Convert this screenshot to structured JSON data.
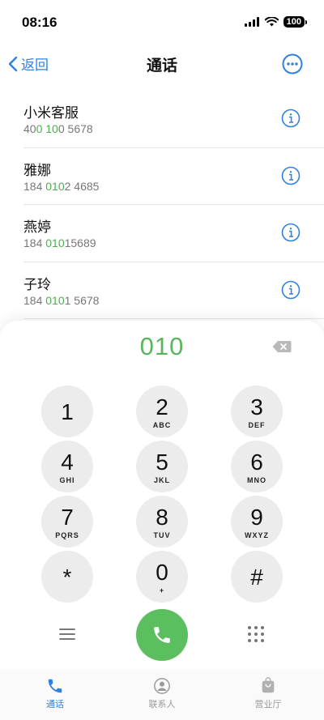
{
  "status_bar": {
    "time": "08:16",
    "battery": "100"
  },
  "nav": {
    "back_label": "返回",
    "title": "通话"
  },
  "contacts": [
    {
      "name": "小米客服",
      "number_parts": [
        "40",
        "0",
        " ",
        "10",
        "0",
        " 5678"
      ],
      "number_hl": [
        false,
        true,
        false,
        true,
        false,
        false
      ]
    },
    {
      "name": "雅娜",
      "number_parts": [
        "184 ",
        "010",
        "2 4685"
      ],
      "number_hl": [
        false,
        true,
        false
      ]
    },
    {
      "name": "燕婷",
      "number_parts": [
        "184 ",
        "010",
        "15689"
      ],
      "number_hl": [
        false,
        true,
        false
      ]
    },
    {
      "name": "子玲",
      "number_parts": [
        "184 ",
        "010",
        "1 5678"
      ],
      "number_hl": [
        false,
        true,
        false
      ]
    }
  ],
  "dial": {
    "entered": "010",
    "keys": [
      {
        "digit": "1",
        "letters": ""
      },
      {
        "digit": "2",
        "letters": "ABC"
      },
      {
        "digit": "3",
        "letters": "DEF"
      },
      {
        "digit": "4",
        "letters": "GHI"
      },
      {
        "digit": "5",
        "letters": "JKL"
      },
      {
        "digit": "6",
        "letters": "MNO"
      },
      {
        "digit": "7",
        "letters": "PQRS"
      },
      {
        "digit": "8",
        "letters": "TUV"
      },
      {
        "digit": "9",
        "letters": "WXYZ"
      },
      {
        "digit": "*",
        "letters": ""
      },
      {
        "digit": "0",
        "letters": "+"
      },
      {
        "digit": "#",
        "letters": ""
      }
    ]
  },
  "tabs": [
    {
      "label": "通话",
      "icon": "phone-icon",
      "active": true
    },
    {
      "label": "联系人",
      "icon": "person-icon",
      "active": false
    },
    {
      "label": "营业厅",
      "icon": "bag-icon",
      "active": false
    }
  ],
  "colors": {
    "accent": "#2f80e0",
    "green": "#58b65b",
    "call": "#5cbf5f"
  }
}
